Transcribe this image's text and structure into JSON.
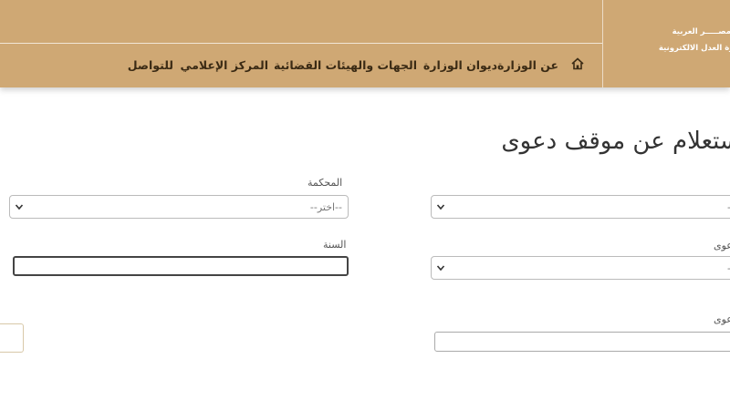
{
  "brand": {
    "line1": "جمهورية مصـــــر العربية",
    "line2": "بوابة وزارة العدل الالكترونية"
  },
  "nav": {
    "items": [
      {
        "label": "عن الوزارة"
      },
      {
        "label": "ديوان الوزارة"
      },
      {
        "label": "الجهات والهيئات القضائية"
      },
      {
        "label": "المركز الإعلامي"
      },
      {
        "label": "للتواصل"
      }
    ]
  },
  "page": {
    "title": "استعلام عن موقف دعوى"
  },
  "form": {
    "court_label": "المحكمة",
    "court_placeholder": "--اختر--",
    "year_label": "السنة",
    "right_select1_placeholder": "--",
    "right_label2": "نوع الدعوى",
    "right_select2_placeholder": "--",
    "right_label3": "رقم الدعوى"
  },
  "colors": {
    "header_bg": "#cfa874"
  }
}
